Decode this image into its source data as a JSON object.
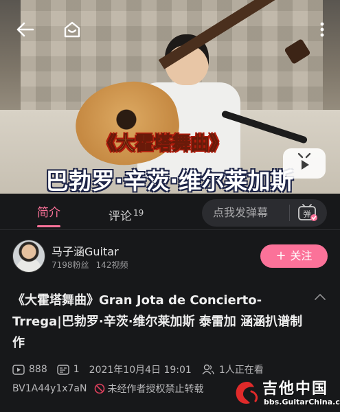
{
  "video": {
    "overlay_title": "《大霍塔舞曲》",
    "overlay_subtitle": "巴勃罗·辛茨·维尔莱加斯",
    "icons": {
      "back": "back-arrow-icon",
      "home": "home-icon",
      "more": "more-vertical-icon",
      "play": "tv-play-icon"
    }
  },
  "tabs": {
    "intro": "简介",
    "comments": "评论",
    "comments_count": "19"
  },
  "danmaku": {
    "placeholder": "点我发弹幕",
    "toggle_icon": "danmaku-toggle-icon"
  },
  "uploader": {
    "name": "马子涵Guitar",
    "followers": "7198粉丝",
    "videos": "142视频",
    "follow_label": "关注",
    "follow_icon": "+"
  },
  "title": "《大霍塔舞曲》Gran Jota de Concierto-Trrega|巴勃罗·辛茨·维尔莱加斯 泰雷加 涵涵扒谱制作",
  "meta": {
    "plays": "888",
    "danmaku_count": "1",
    "datetime": "2021年10月4日 19:01",
    "watching": "1人正在看",
    "bvid": "BV1A44y1x7aN",
    "copyright": "未经作者授权禁止转载"
  },
  "watermark": {
    "brand": "吉他中国",
    "site": "bbs.GuitarChina.com"
  },
  "colors": {
    "accent": "#fb7299",
    "background": "#17181a"
  }
}
